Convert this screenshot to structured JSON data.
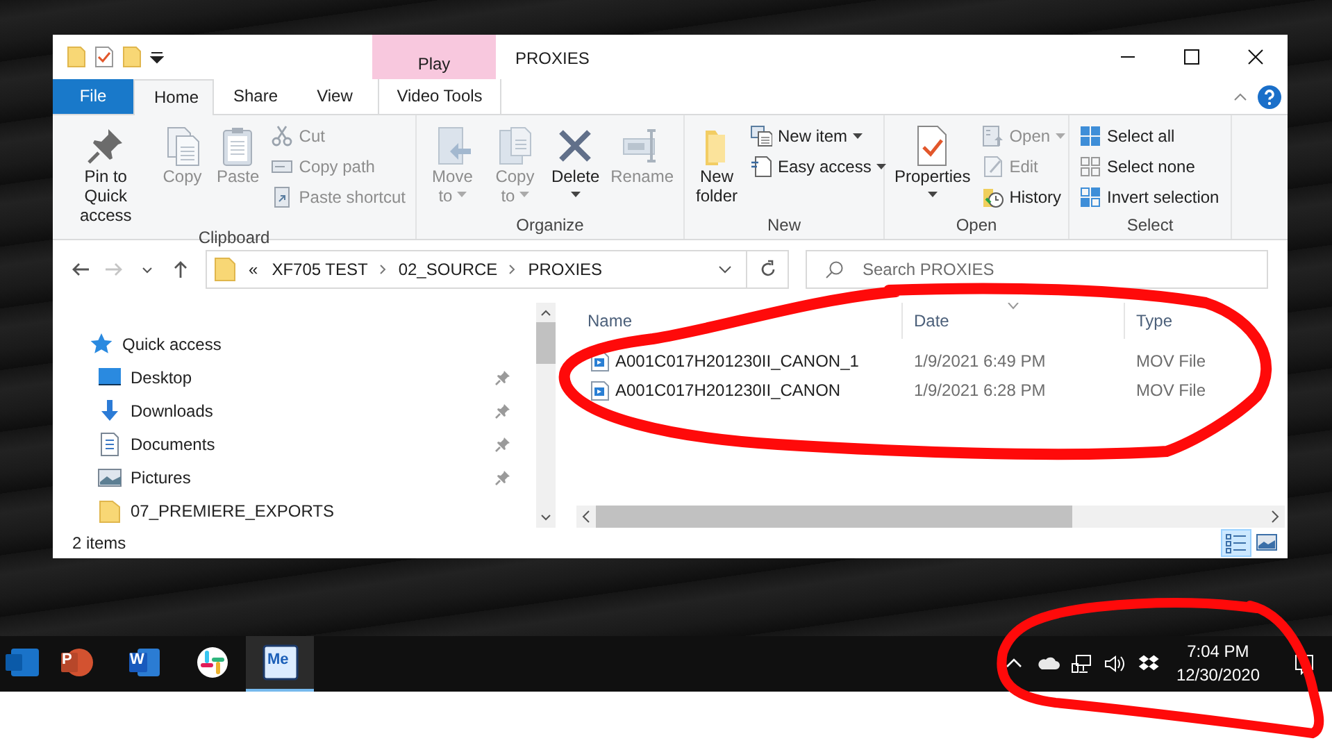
{
  "window": {
    "title": "PROXIES",
    "contextual_header": "Play"
  },
  "ribbon_tabs": [
    {
      "label": "File",
      "kind": "file",
      "selected": false
    },
    {
      "label": "Home",
      "kind": "tab",
      "selected": true
    },
    {
      "label": "Share",
      "kind": "tab",
      "selected": false
    },
    {
      "label": "View",
      "kind": "tab",
      "selected": false
    },
    {
      "label": "Video Tools",
      "kind": "contextual",
      "selected": false
    }
  ],
  "ribbon_groups": [
    {
      "label": "Clipboard",
      "commands": [
        {
          "label": "Pin to Quick access",
          "kind": "large",
          "disabled": false,
          "dropdown": false
        },
        {
          "label": "Copy",
          "kind": "large",
          "disabled": true,
          "dropdown": false
        },
        {
          "label": "Paste",
          "kind": "large",
          "disabled": true,
          "dropdown": false
        },
        {
          "label": "Cut",
          "kind": "small",
          "disabled": true,
          "dropdown": false
        },
        {
          "label": "Copy path",
          "kind": "small",
          "disabled": true,
          "dropdown": false
        },
        {
          "label": "Paste shortcut",
          "kind": "small",
          "disabled": true,
          "dropdown": false
        }
      ]
    },
    {
      "label": "Organize",
      "commands": [
        {
          "label": "Move to",
          "kind": "large",
          "disabled": true,
          "dropdown": true
        },
        {
          "label": "Copy to",
          "kind": "large",
          "disabled": true,
          "dropdown": true
        },
        {
          "label": "Delete",
          "kind": "large",
          "disabled": false,
          "dropdown": true
        },
        {
          "label": "Rename",
          "kind": "large",
          "disabled": true,
          "dropdown": false
        }
      ]
    },
    {
      "label": "New",
      "commands": [
        {
          "label": "New folder",
          "kind": "large",
          "disabled": false,
          "dropdown": false
        },
        {
          "label": "New item",
          "kind": "small",
          "disabled": false,
          "dropdown": true
        },
        {
          "label": "Easy access",
          "kind": "small",
          "disabled": false,
          "dropdown": true
        }
      ]
    },
    {
      "label": "Open",
      "commands": [
        {
          "label": "Properties",
          "kind": "large",
          "disabled": false,
          "dropdown": true
        },
        {
          "label": "Open",
          "kind": "small",
          "disabled": true,
          "dropdown": true
        },
        {
          "label": "Edit",
          "kind": "small",
          "disabled": true,
          "dropdown": false
        },
        {
          "label": "History",
          "kind": "small",
          "disabled": false,
          "dropdown": false
        }
      ]
    },
    {
      "label": "Select",
      "commands": [
        {
          "label": "Select all",
          "kind": "small",
          "disabled": false,
          "dropdown": false
        },
        {
          "label": "Select none",
          "kind": "small",
          "disabled": false,
          "dropdown": false
        },
        {
          "label": "Invert selection",
          "kind": "small",
          "disabled": false,
          "dropdown": false
        }
      ]
    }
  ],
  "nav_buttons": [
    {
      "kind": "back",
      "disabled": false
    },
    {
      "kind": "forward",
      "disabled": true
    },
    {
      "kind": "recent",
      "disabled": false
    },
    {
      "kind": "up",
      "disabled": false
    }
  ],
  "address": {
    "overflow": "«",
    "segments": [
      "XF705 TEST",
      "02_SOURCE",
      "PROXIES"
    ]
  },
  "search": {
    "placeholder": "Search PROXIES"
  },
  "nav_pane": {
    "items": [
      {
        "label": "Quick access",
        "kind": "quick_access",
        "pinned": false
      },
      {
        "label": "Desktop",
        "kind": "desktop",
        "pinned": true
      },
      {
        "label": "Downloads",
        "kind": "downloads",
        "pinned": true
      },
      {
        "label": "Documents",
        "kind": "documents",
        "pinned": true
      },
      {
        "label": "Pictures",
        "kind": "pictures",
        "pinned": true
      },
      {
        "label": "07_PREMIERE_EXPORTS",
        "kind": "folder",
        "pinned": false
      }
    ]
  },
  "file_list": {
    "columns": [
      {
        "label": "Name",
        "sorted": false
      },
      {
        "label": "Date",
        "sorted": true
      },
      {
        "label": "Type",
        "sorted": false
      }
    ],
    "rows": [
      {
        "name": "A001C017H201230II_CANON_1",
        "date": "1/9/2021 6:49 PM",
        "type": "MOV File"
      },
      {
        "name": "A001C017H201230II_CANON",
        "date": "1/9/2021 6:28 PM",
        "type": "MOV File"
      }
    ]
  },
  "status_bar": {
    "item_count": "2 items",
    "views": [
      {
        "kind": "details",
        "selected": true
      },
      {
        "kind": "large_icons",
        "selected": false
      }
    ]
  },
  "taskbar": {
    "apps": [
      {
        "kind": "outlook",
        "active": false
      },
      {
        "kind": "powerpoint",
        "letter": "P",
        "active": false
      },
      {
        "kind": "word",
        "letter": "W",
        "active": false
      },
      {
        "kind": "slack",
        "active": false
      },
      {
        "kind": "media_encoder",
        "letter": "Me",
        "active": true
      }
    ],
    "time": "7:04 PM",
    "date": "12/30/2020"
  }
}
